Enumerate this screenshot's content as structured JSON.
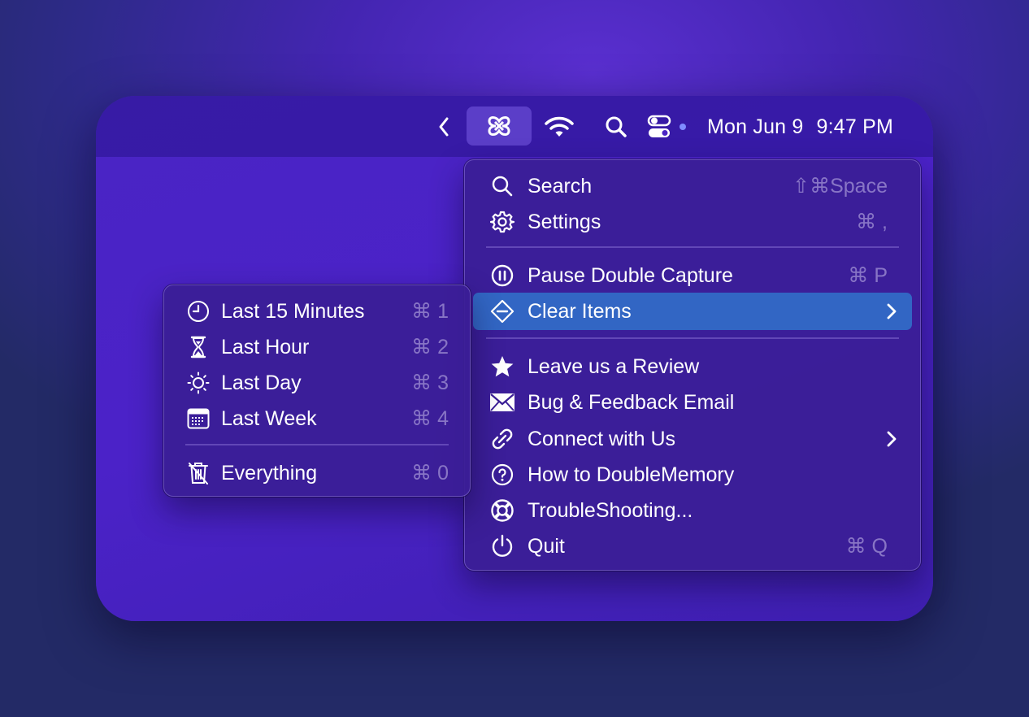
{
  "menubar": {
    "chevron_icon": "chevron-left-icon",
    "app_icon": "double-capture-app-icon",
    "wifi_icon": "wifi-icon",
    "search_icon": "search-icon",
    "control_center_icon": "control-center-icon",
    "date": "Mon Jun 9",
    "time": "9:47 PM"
  },
  "main_menu": {
    "items": [
      {
        "label": "Search",
        "shortcut": "⇧⌘Space",
        "icon": "search-icon"
      },
      {
        "label": "Settings",
        "shortcut": "⌘ ,",
        "icon": "gear-icon"
      },
      {
        "label": "Pause Double Capture",
        "shortcut": "⌘ P",
        "icon": "pause-circle-icon"
      },
      {
        "label": "Clear Items",
        "shortcut": "",
        "icon": "clear-diamond-icon",
        "highlighted": true,
        "submenu": true
      },
      {
        "label": "Leave us a Review",
        "shortcut": "",
        "icon": "star-icon"
      },
      {
        "label": "Bug & Feedback Email",
        "shortcut": "",
        "icon": "envelope-icon"
      },
      {
        "label": "Connect with Us",
        "shortcut": "",
        "icon": "link-icon",
        "submenu": true
      },
      {
        "label": "How to DoubleMemory",
        "shortcut": "",
        "icon": "question-circle-icon"
      },
      {
        "label": "TroubleShooting...",
        "shortcut": "",
        "icon": "lifebuoy-icon"
      },
      {
        "label": "Quit",
        "shortcut": "⌘ Q",
        "icon": "power-icon"
      }
    ]
  },
  "clear_submenu": {
    "items": [
      {
        "label": "Last 15 Minutes",
        "shortcut": "⌘ 1",
        "icon": "clock-icon"
      },
      {
        "label": "Last Hour",
        "shortcut": "⌘ 2",
        "icon": "hourglass-icon"
      },
      {
        "label": "Last Day",
        "shortcut": "⌘ 3",
        "icon": "sun-icon"
      },
      {
        "label": "Last Week",
        "shortcut": "⌘ 4",
        "icon": "calendar-icon"
      },
      {
        "label": "Everything",
        "shortcut": "⌘ 0",
        "icon": "trash-slash-icon"
      }
    ]
  },
  "colors": {
    "highlight": "#3266c4",
    "menu_background": "#3a1e96",
    "background": "#4425b2"
  }
}
